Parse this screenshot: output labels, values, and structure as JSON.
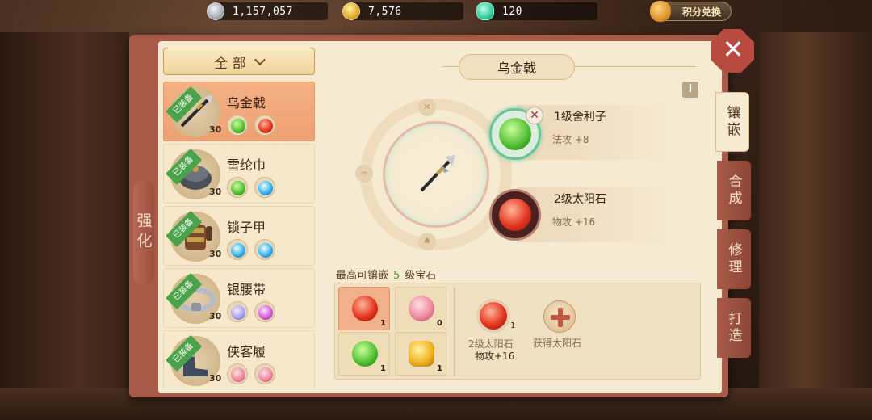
{
  "currencies": {
    "silver": {
      "value": "1,157,057",
      "icon": "silver-coin-icon"
    },
    "gold": {
      "value": "7,576",
      "icon": "gold-coin-icon"
    },
    "jade": {
      "value": "120",
      "icon": "jade-icon"
    },
    "exchange_label": "积分兑换"
  },
  "left_tab_label": "强化",
  "filter": {
    "label": "全 部"
  },
  "equipment": [
    {
      "name": "乌金戟",
      "level": "30",
      "badge": "已装备",
      "gems": [
        "green",
        "red"
      ]
    },
    {
      "name": "雪纶巾",
      "level": "30",
      "badge": "已装备",
      "gems": [
        "green",
        "blue"
      ]
    },
    {
      "name": "锁子甲",
      "level": "30",
      "badge": "已装备",
      "gems": [
        "blue",
        "blue"
      ]
    },
    {
      "name": "银腰带",
      "level": "30",
      "badge": "已装备",
      "gems": [
        "moon",
        "pink"
      ]
    },
    {
      "name": "侠客履",
      "level": "30",
      "badge": "已装备",
      "gems": [
        "rose",
        "rose"
      ]
    }
  ],
  "detail": {
    "title": "乌金戟",
    "info_label": "i",
    "sockets": [
      {
        "name": "1级舍利子",
        "stat": "法攻  +8",
        "gem": "green"
      },
      {
        "name": "2级太阳石",
        "stat": "物攻  +16",
        "gem": "red"
      }
    ]
  },
  "inventory": {
    "max_prefix": "最高可镶嵌",
    "max_level": "5",
    "max_suffix": "级宝石",
    "cells": [
      {
        "gem": "red",
        "count": "1"
      },
      {
        "gem": "rose",
        "count": "0"
      },
      {
        "gem": "green",
        "count": "1"
      },
      {
        "gem": "yellow",
        "count": "1"
      }
    ],
    "selected": {
      "count": "1",
      "name": "2级太阳石",
      "stat": "物攻+16"
    },
    "obtain_label": "获得太阳石"
  },
  "right_tabs": [
    "镶嵌",
    "合成",
    "修理",
    "打造"
  ],
  "colors": {
    "accent": "#a85a48",
    "panel": "#f6ead2",
    "highlight": "#f4b286",
    "level_green": "#4a9a2a"
  }
}
